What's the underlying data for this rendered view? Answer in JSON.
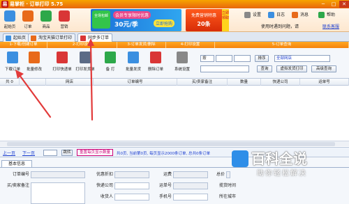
{
  "window": {
    "title": "易掌柜 · 订单打印 5.75",
    "logo_char": "易",
    "min": "─",
    "max": "□",
    "close": "✕"
  },
  "toolbar": {
    "buttons": [
      {
        "label": "起始页",
        "color": "#3b8fe0",
        "icon": "home-icon"
      },
      {
        "label": "订单",
        "color": "#e86a1a",
        "icon": "order-icon"
      },
      {
        "label": "商品",
        "color": "#2da84a",
        "icon": "goods-icon"
      },
      {
        "label": "营销",
        "color": "#d93636",
        "icon": "marketing-icon"
      }
    ],
    "ad1": {
      "badge": "全场包邮",
      "line1": "会员专享限时优惠",
      "price": "30元/季",
      "cta": "立即抢购"
    },
    "ad2": {
      "line1": "免费营销特惠",
      "line2": "20条",
      "side": "立即领取"
    },
    "right": [
      {
        "label": "设置",
        "color": "#888",
        "icon": "gear-icon"
      },
      {
        "label": "日志",
        "color": "#3b8fe0",
        "icon": "log-icon"
      },
      {
        "label": "消息",
        "color": "#e86a1a",
        "icon": "message-icon"
      },
      {
        "label": "帮助",
        "color": "#2da84a",
        "icon": "help-icon"
      }
    ],
    "user_status": "使用时遇到问题，请",
    "switch_link": "联系客服"
  },
  "tabs": [
    {
      "label": "起始页",
      "color": "#3b8fe0"
    },
    {
      "label": "淘宝天猫订单打印",
      "color": "#e86a1a"
    },
    {
      "label": "同步多订单",
      "color": "#d93636"
    }
  ],
  "steps": [
    "1-下载/创建订单",
    "2-打印设置",
    "3-订单发货/删除",
    "4-打印设置",
    "5-订单查询"
  ],
  "actions": [
    {
      "label": "下载订单",
      "color": "#3b8fe0",
      "icon": "download-icon"
    },
    {
      "label": "批量修改",
      "color": "#e86a1a",
      "icon": "batch-edit-icon"
    },
    {
      "label": "打印快递单",
      "color": "#d93636",
      "icon": "print-express-icon"
    },
    {
      "label": "打印发货单",
      "color": "#5b6b86",
      "icon": "print-invoice-icon"
    },
    {
      "label": "备 打",
      "color": "#2da84a",
      "icon": "note-print-icon"
    },
    {
      "label": "批量发货",
      "color": "#3b8fe0",
      "icon": "batch-ship-icon"
    },
    {
      "label": "删除订单",
      "color": "#d93636",
      "icon": "delete-icon"
    },
    {
      "label": "系统设置",
      "color": "#888",
      "icon": "settings-icon"
    }
  ],
  "filters": {
    "time_select": "按",
    "shop_select": "全部网店",
    "sort_btn": "排序",
    "query_btn": "查询",
    "reset_btn": "返回",
    "print_query_btn": "虚拟发货打印",
    "adv_query_btn": "高级查询"
  },
  "grid": {
    "columns": [
      "共 0",
      "网店",
      "订单编号",
      "买/卖家备注",
      "数量",
      "快递公司",
      "运单号"
    ]
  },
  "pagination": {
    "prev": "上一页",
    "next": "下一页",
    "jump": "跳转",
    "reset": "重置每页显示数量",
    "info": "共0页, 当前第0页, 每页显示2000条订单, 总共0条订单"
  },
  "detail": {
    "tab": "基本信息",
    "labels": [
      "订单编号",
      "优惠折扣",
      "运费",
      "总价",
      "买/卖家备注",
      "快递公司",
      "运单号",
      "揽货时间",
      "收货人",
      "手机号",
      "所在城市"
    ]
  },
  "watermark": {
    "title": "百科全说",
    "sub": "助你轻松解决"
  }
}
